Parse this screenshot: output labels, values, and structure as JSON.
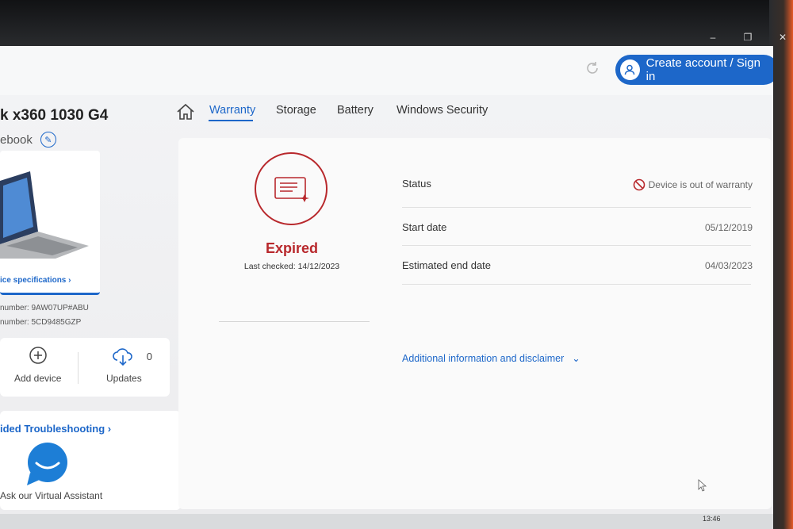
{
  "window": {
    "controls": [
      "–",
      "❐",
      "✕"
    ]
  },
  "topbar": {
    "signin_label": "Create account / Sign in",
    "refresh_icon": "refresh-icon",
    "accent": "#1d67c9"
  },
  "device": {
    "title": "k x360 1030 G4",
    "subtitle": "ebook",
    "spec_link": "ice specifications ›",
    "product_number": "number: 9AW07UP#ABU",
    "serial_number": "number: 5CD9485GZP"
  },
  "actions": {
    "add_device": "Add device",
    "updates": "Updates",
    "updates_count": "0"
  },
  "assistant": {
    "link": "ided Troubleshooting ›",
    "label": "Ask our Virtual Assistant"
  },
  "tabs": [
    {
      "label": "Warranty",
      "active": true
    },
    {
      "label": "Storage",
      "active": false
    },
    {
      "label": "Battery",
      "active": false
    },
    {
      "label": "Windows Security",
      "active": false
    }
  ],
  "warranty": {
    "state": "Expired",
    "last_checked": "Last checked: 14/12/2023",
    "status_color": "#b8282c",
    "rows": [
      {
        "label": "Status",
        "value": "Device is out of warranty"
      },
      {
        "label": "Start date",
        "value": "05/12/2019"
      },
      {
        "label": "Estimated end date",
        "value": "04/03/2023"
      }
    ],
    "disclaimer": "Additional information and disclaimer"
  },
  "taskbar": {
    "time": "13:46"
  }
}
